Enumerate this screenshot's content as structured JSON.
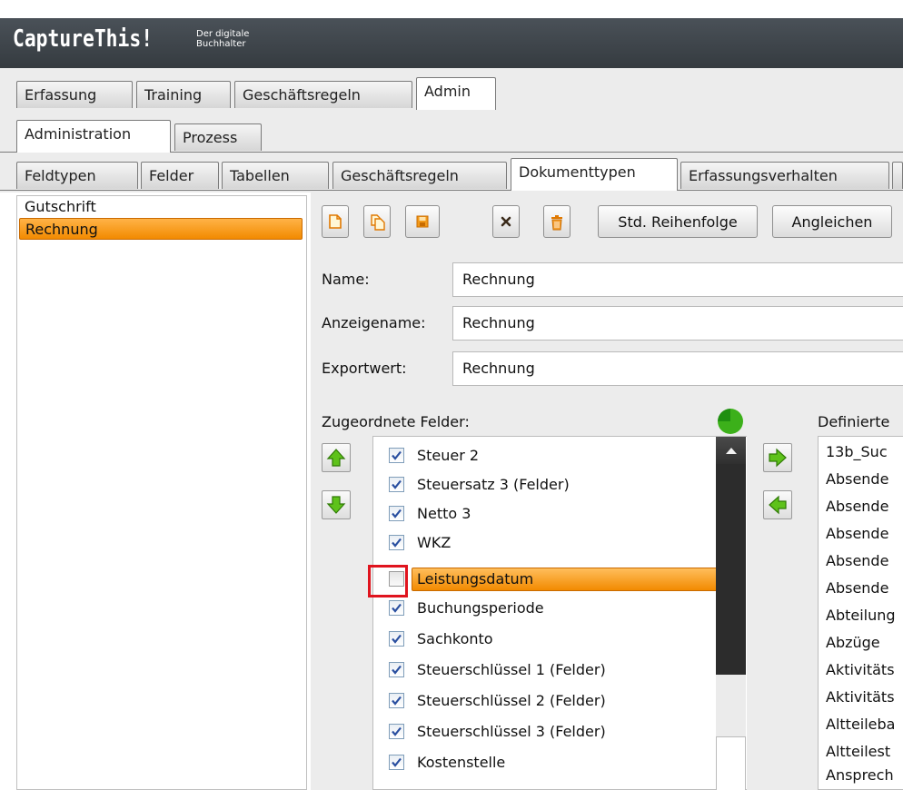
{
  "app": {
    "title": "CaptureThis!",
    "subtitle_line1": "Der digitale",
    "subtitle_line2": "Buchhalter"
  },
  "main_tabs": [
    {
      "label": "Erfassung",
      "active": false
    },
    {
      "label": "Training",
      "active": false
    },
    {
      "label": "Geschäftsregeln",
      "active": false
    },
    {
      "label": "Admin",
      "active": true
    }
  ],
  "sub_tabs": [
    {
      "label": "Administration",
      "active": true
    },
    {
      "label": "Prozess",
      "active": false
    }
  ],
  "admin_tabs": [
    {
      "label": "Feldtypen",
      "active": false
    },
    {
      "label": "Felder",
      "active": false
    },
    {
      "label": "Tabellen",
      "active": false
    },
    {
      "label": "Geschäftsregeln",
      "active": false
    },
    {
      "label": "Dokumenttypen",
      "active": true
    },
    {
      "label": "Erfassungsverhalten",
      "active": false
    }
  ],
  "document_types": [
    {
      "label": "Gutschrift",
      "selected": false
    },
    {
      "label": "Rechnung",
      "selected": true
    }
  ],
  "toolbar": {
    "new_icon": "new-document-icon",
    "copy_icon": "copy-document-icon",
    "save_icon": "save-icon",
    "delete_icon": "delete-x-icon",
    "trash_icon": "trash-icon",
    "std_order_label": "Std. Reihenfolge",
    "align_label": "Angleichen"
  },
  "form": {
    "name_label": "Name:",
    "name_value": "Rechnung",
    "display_name_label": "Anzeigename:",
    "display_name_value": "Rechnung",
    "export_label": "Exportwert:",
    "export_value": "Rechnung"
  },
  "assigned_fields": {
    "label": "Zugeordnete Felder:",
    "items": [
      {
        "label": "Steuer 2",
        "checked": true,
        "selected": false
      },
      {
        "label": "Steuersatz 3 (Felder)",
        "checked": true,
        "selected": false
      },
      {
        "label": "Netto 3",
        "checked": true,
        "selected": false
      },
      {
        "label": "WKZ",
        "checked": true,
        "selected": false
      },
      {
        "label": "Leistungsdatum",
        "checked": false,
        "selected": true
      },
      {
        "label": "Buchungsperiode",
        "checked": true,
        "selected": false
      },
      {
        "label": "Sachkonto",
        "checked": true,
        "selected": false
      },
      {
        "label": "Steuerschlüssel 1 (Felder)",
        "checked": true,
        "selected": false
      },
      {
        "label": "Steuerschlüssel 2 (Felder)",
        "checked": true,
        "selected": false
      },
      {
        "label": "Steuerschlüssel 3 (Felder)",
        "checked": true,
        "selected": false
      },
      {
        "label": "Kostenstelle",
        "checked": true,
        "selected": false
      }
    ]
  },
  "defined_fields": {
    "label": "Definierte",
    "items": [
      "13b_Suc",
      "Absende",
      "Absende",
      "Absende",
      "Absende",
      "Absende",
      "Abteilung",
      "Abzüge",
      "Aktivitäts",
      "Aktivitäts",
      "Altteileba",
      "Altteilest",
      "Ansprech"
    ]
  },
  "colors": {
    "titlebar": "#3d4349",
    "selection_orange": "#f28a00",
    "arrow_green": "#5ec21a",
    "highlight_red": "#e0141e"
  }
}
